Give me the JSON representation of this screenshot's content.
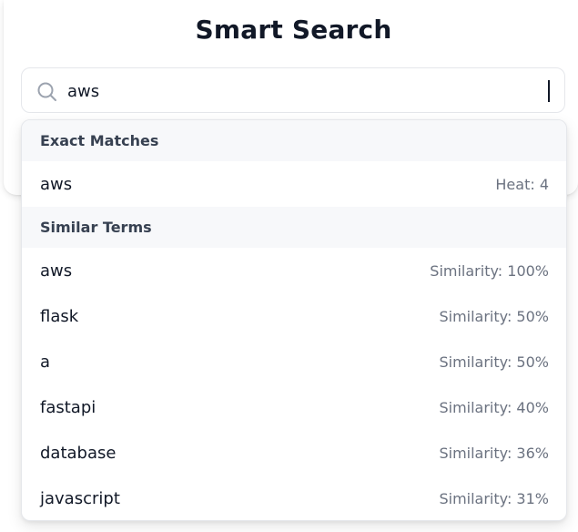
{
  "header": {
    "title": "Smart Search"
  },
  "search": {
    "value": "aws",
    "icon": "search-icon"
  },
  "dropdown": {
    "exact": {
      "header": "Exact Matches",
      "items": [
        {
          "term": "aws",
          "meta": "Heat: 4"
        }
      ]
    },
    "similar": {
      "header": "Similar Terms",
      "items": [
        {
          "term": "aws",
          "meta": "Similarity: 100%"
        },
        {
          "term": "flask",
          "meta": "Similarity: 50%"
        },
        {
          "term": "a",
          "meta": "Similarity: 50%"
        },
        {
          "term": "fastapi",
          "meta": "Similarity: 40%"
        },
        {
          "term": "database",
          "meta": "Similarity: 36%"
        },
        {
          "term": "javascript",
          "meta": "Similarity: 31%"
        }
      ]
    }
  },
  "colors": {
    "text": "#111827",
    "muted": "#6b7280",
    "section_bg": "#f7f8fa",
    "border": "#e5e7eb"
  }
}
